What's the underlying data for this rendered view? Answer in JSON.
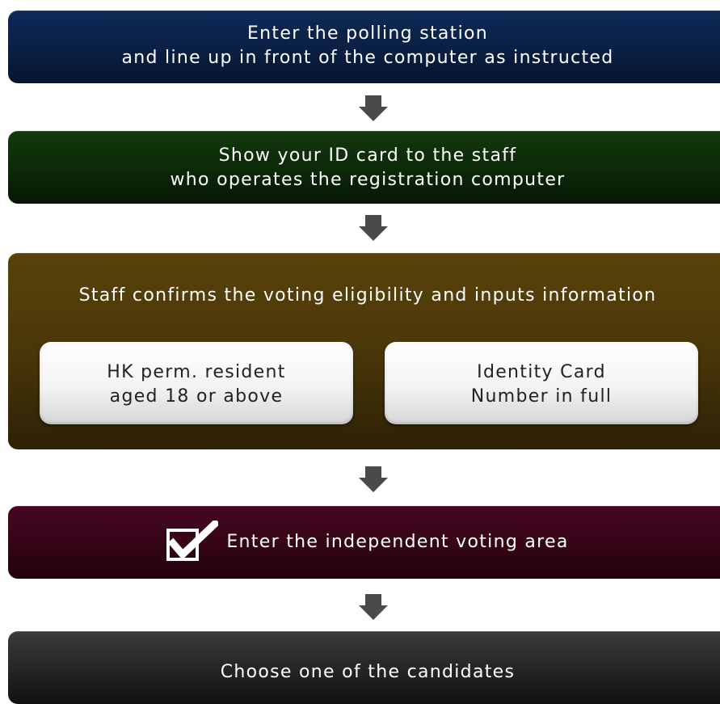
{
  "steps": {
    "step1": {
      "line1": "Enter the polling station",
      "line2": "and line up in front of the computer as instructed",
      "color": "#0b2147"
    },
    "step2": {
      "line1": "Show your ID card to the staff",
      "line2": "who operates the registration computer",
      "color": "#0c2a08"
    },
    "step3": {
      "heading": "Staff confirms the voting eligibility and inputs information",
      "color": "#4a3709",
      "boxes": [
        {
          "line1": "HK perm. resident",
          "line2": "aged 18 or above"
        },
        {
          "line1": "Identity Card",
          "line2": "Number in full"
        }
      ]
    },
    "step4": {
      "text": "Enter the independent voting area",
      "icon": "checkbox-check-icon",
      "color": "#360518"
    },
    "step5": {
      "text": "Choose one of the candidates",
      "color": "#262626"
    }
  },
  "arrow_icon": "down-arrow-icon"
}
